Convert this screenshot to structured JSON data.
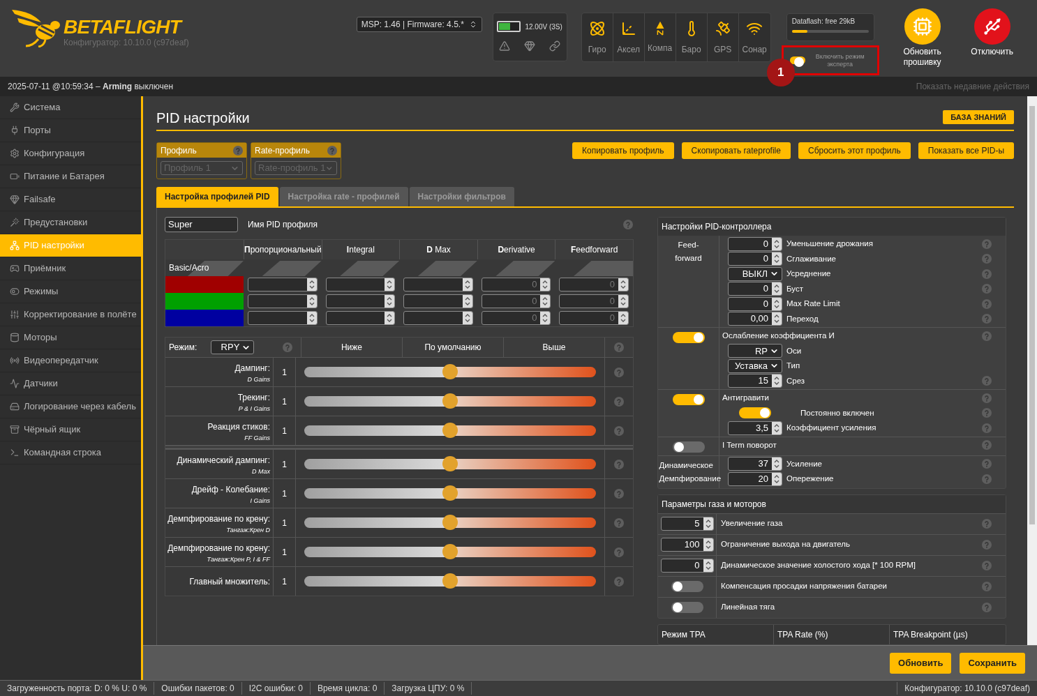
{
  "header": {
    "logo": {
      "title": "BETAFLIGHT",
      "subtitle": "Конфигуратор: 10.10.0 (c97deaf)"
    },
    "firmware_select": "MSP: 1.46 | Firmware: 4.5.*",
    "battery": {
      "reading": "12.00V (3S)",
      "level": 0.55
    },
    "sensors": [
      {
        "label": "Гиро",
        "active": true
      },
      {
        "label": "Аксел",
        "active": true
      },
      {
        "label": "Компа",
        "active": true
      },
      {
        "label": "Баро",
        "active": true
      },
      {
        "label": "GPS",
        "active": true
      },
      {
        "label": "Сонар",
        "active": true
      }
    ],
    "dataflash": {
      "label": "Dataflash: free 29kB",
      "level": 0.2
    },
    "expert_mode": {
      "label": "Включить режим эксперта",
      "on": true,
      "highlighted": true
    },
    "annotation": "1",
    "buttons": [
      {
        "kind": "update",
        "label": "Обновить прошивку"
      },
      {
        "kind": "disconnect",
        "label": "Отключить"
      }
    ]
  },
  "status_line": {
    "text": "2025-07-11 @10:59:34 – **Arming** выключен",
    "link": "Показать недавние действия"
  },
  "sidebar": {
    "items": [
      {
        "label": "Система",
        "selected": false
      },
      {
        "label": "Порты",
        "selected": false
      },
      {
        "label": "Конфигурация",
        "selected": false
      },
      {
        "label": "Питание и Батарея",
        "selected": false
      },
      {
        "label": "Failsafe",
        "selected": false
      },
      {
        "label": "Предустановки",
        "selected": false
      },
      {
        "label": "PID настройки",
        "selected": true
      },
      {
        "label": "Приёмник",
        "selected": false
      },
      {
        "label": "Режимы",
        "selected": false
      },
      {
        "label": "Корректирование в полёте",
        "selected": false
      },
      {
        "label": "Моторы",
        "selected": false
      },
      {
        "label": "Видеопередатчик",
        "selected": false
      },
      {
        "label": "Датчики",
        "selected": false
      },
      {
        "label": "Логирование через кабель",
        "selected": false
      },
      {
        "label": "Чёрный ящик",
        "selected": false
      },
      {
        "label": "Командная строка",
        "selected": false
      }
    ]
  },
  "page": {
    "title": "PID настройки",
    "wiki_button": "БАЗА ЗНАНИЙ",
    "profile_selectors": [
      {
        "title": "Профиль",
        "value": "Профиль 1",
        "disabled": true
      },
      {
        "title": "Rate-профиль",
        "value": "Rate-профиль 1",
        "disabled": true
      }
    ],
    "actions": [
      "Копировать профиль",
      "Скопировать rateprofile",
      "Сбросить этот профиль",
      "Показать все PID-ы"
    ],
    "tabs": [
      {
        "label": "Настройка профилей PID",
        "selected": true
      },
      {
        "label": "Настройка rate - профилей",
        "selected": false
      },
      {
        "label": "Настройки фильтров",
        "selected": false
      }
    ],
    "profile_name": {
      "value": "Super",
      "label": "Имя PID профиля"
    },
    "pid_table": {
      "columns": [
        "**П**ропорциональный",
        "**I**ntegral",
        "**D** Max",
        "**D**erivative",
        "**F**eedforward"
      ],
      "group_label": "Basic/Acro",
      "rows": [
        {
          "color": "#a00000",
          "cells": [
            {},
            {},
            {},
            {
              "placeholder": "0"
            },
            {
              "placeholder": "0"
            }
          ]
        },
        {
          "color": "#00a000",
          "cells": [
            {},
            {},
            {},
            {
              "placeholder": "0"
            },
            {
              "placeholder": "0"
            }
          ]
        },
        {
          "color": "#0000a0",
          "cells": [
            {},
            {},
            {},
            {
              "placeholder": "0"
            },
            {
              "placeholder": "0"
            }
          ]
        }
      ]
    },
    "sliders": {
      "mode_label": "Режим:",
      "mode": "RPY",
      "columns": [
        "Ниже",
        "По умолчанию",
        "Выше"
      ],
      "groups": [
        [
          {
            "label": "Дампинг:",
            "sublabel": "D Gains",
            "value": "1",
            "level": 0.5
          },
          {
            "label": "Трекинг:",
            "sublabel": "P & I Gains",
            "value": "1",
            "level": 0.5
          },
          {
            "label": "Реакция стиков:",
            "sublabel": "FF Gains",
            "value": "1",
            "level": 0.5
          }
        ],
        [
          {
            "label": "Динамический дампинг:",
            "sublabel": "D Max",
            "value": "1",
            "level": 0.5
          },
          {
            "label": "Дрейф - Колебание:",
            "sublabel": "I Gains",
            "value": "1",
            "level": 0.5
          },
          {
            "label": "Демпфирование по крену:",
            "sublabel": "Тангаж:Крен D",
            "value": "1",
            "level": 0.5
          },
          {
            "label": "Демпфирование по крену:",
            "sublabel": "Тангаж:Крен P, I & FF",
            "value": "1",
            "level": 0.5
          },
          {
            "label": "Главный множитель:",
            "value": "1",
            "level": 0.5
          }
        ]
      ]
    },
    "pid_controller": {
      "title": "Настройки PID-контроллера",
      "groups": [
        {
          "side": {
            "kind": "label",
            "text": "Feed-forward"
          },
          "rows": [
            {
              "kind": "number",
              "value": "0",
              "label": "Уменьшение дрожания",
              "help": true
            },
            {
              "kind": "number",
              "value": "0",
              "label": "Сглаживание",
              "help": true
            },
            {
              "kind": "select",
              "value": "ВЫКЛ",
              "label": "Усреднение",
              "help": true
            },
            {
              "kind": "number",
              "value": "0",
              "label": "Буст",
              "help": true
            },
            {
              "kind": "number",
              "value": "0",
              "label": "Max Rate Limit",
              "help": true
            },
            {
              "kind": "number",
              "value": "0,00",
              "label": "Переход",
              "help": true
            }
          ]
        },
        {
          "side": {
            "kind": "toggle",
            "on": true
          },
          "rows": [
            {
              "kind": "heading",
              "label": "Ослабление коэффициента И",
              "help": true
            },
            {
              "kind": "select",
              "value": "RP",
              "label": "Оси",
              "help": false
            },
            {
              "kind": "select",
              "value": "Уставка",
              "label": "Тип",
              "help": false
            },
            {
              "kind": "number",
              "value": "15",
              "label": "Срез",
              "help": true
            }
          ]
        },
        {
          "side": {
            "kind": "toggle",
            "on": true
          },
          "rows": [
            {
              "kind": "heading",
              "label": "Антигравити",
              "help": true
            },
            {
              "kind": "toggle",
              "on": true,
              "label": "Постоянно включен",
              "help": true
            },
            {
              "kind": "number",
              "value": "3,5",
              "label": "Коэффициент усиления",
              "help": true
            }
          ]
        },
        {
          "side": {
            "kind": "toggle",
            "on": false
          },
          "rows": [
            {
              "kind": "heading",
              "label": "I Term поворот",
              "help": true
            }
          ]
        },
        {
          "side": {
            "kind": "label",
            "text": "Динамическое Демпфирование"
          },
          "rows": [
            {
              "kind": "number",
              "value": "37",
              "label": "Усиление",
              "help": true
            },
            {
              "kind": "number",
              "value": "20",
              "label": "Опережение",
              "help": true
            }
          ]
        }
      ]
    },
    "throttle": {
      "title": "Параметры газа и моторов",
      "rows": [
        {
          "kind": "number",
          "value": "5",
          "label": "Увеличение газа"
        },
        {
          "kind": "number",
          "value": "100",
          "label": "Ограничение выхода на двигатель"
        },
        {
          "kind": "number",
          "value": "0",
          "label": "Динамическое значение холостого хода [* 100 RPM]"
        },
        {
          "kind": "toggle",
          "on": false,
          "label": "Компенсация просадки напряжения батареи"
        },
        {
          "kind": "toggle",
          "on": false,
          "label": "Линейная тяга"
        }
      ]
    },
    "tpa": {
      "columns": [
        "Режим TPA",
        "TPA Rate (%)",
        "TPA Breakpoint (µs)"
      ]
    }
  },
  "bottom_buttons": [
    "Обновить",
    "Сохранить"
  ],
  "footer": {
    "stats": [
      "Загруженность порта: D: 0 % U: 0 %",
      "Ошибки пакетов: 0",
      "I2C ошибки: 0",
      "Время цикла: 0",
      "Загрузка ЦПУ: 0 %"
    ],
    "version": "Конфигуратор: 10.10.0 (c97deaf)"
  }
}
